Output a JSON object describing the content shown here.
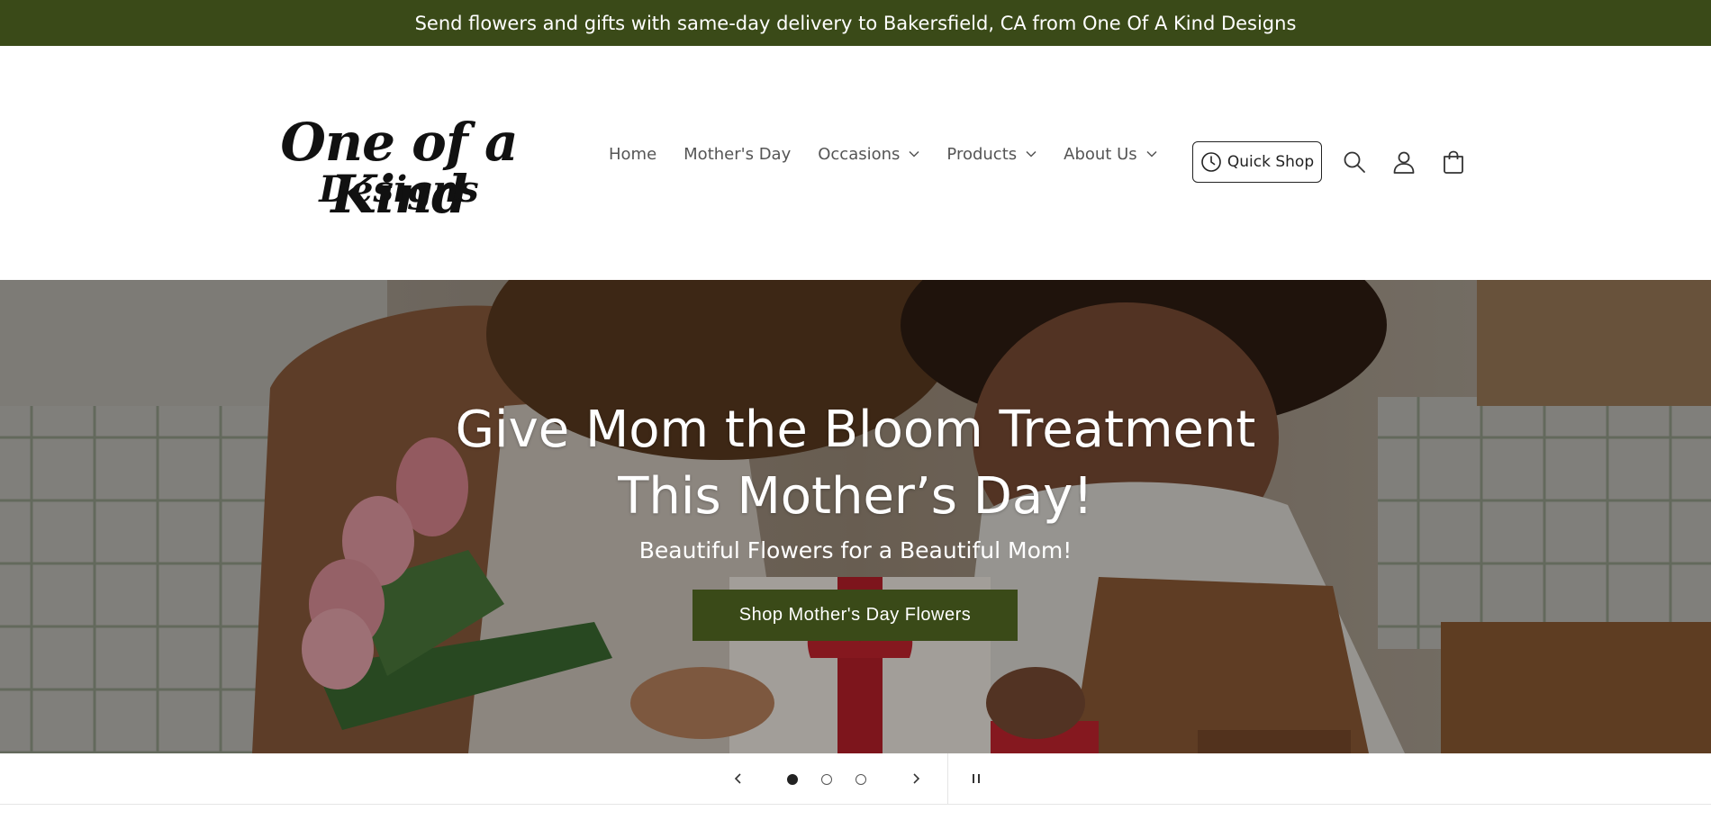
{
  "announcement": "Send flowers and gifts with same-day delivery to Bakersfield, CA from One Of A Kind Designs",
  "logo": {
    "line1": "One of a Kind",
    "line2": "Designs"
  },
  "nav": [
    {
      "label": "Home",
      "dropdown": false
    },
    {
      "label": "Mother's Day",
      "dropdown": false
    },
    {
      "label": "Occasions",
      "dropdown": true
    },
    {
      "label": "Products",
      "dropdown": true
    },
    {
      "label": "About Us",
      "dropdown": true
    }
  ],
  "header_actions": {
    "quick_shop_label": "Quick Shop",
    "icons": [
      "clock-icon",
      "search-icon",
      "account-icon",
      "cart-icon"
    ]
  },
  "hero": {
    "title_line1": "Give Mom the Bloom Treatment",
    "title_line2": "This Mother’s Day!",
    "subtitle": "Beautiful Flowers for a Beautiful Mom!",
    "cta_label": "Shop Mother's Day Flowers"
  },
  "slider": {
    "slide_count": 3,
    "active_slide": 1,
    "icons": [
      "chevron-left-icon",
      "chevron-right-icon",
      "pause-icon"
    ]
  },
  "colors": {
    "brand_green": "#3a4a18",
    "nav_text": "#555555",
    "white": "#ffffff"
  }
}
